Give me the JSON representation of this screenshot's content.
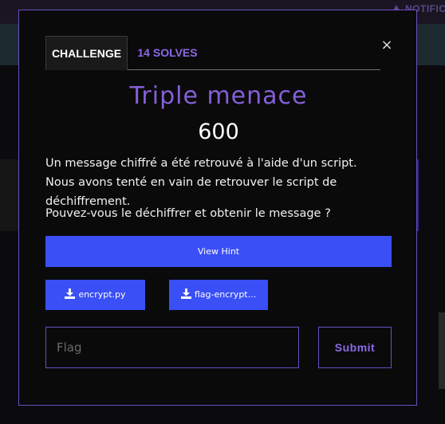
{
  "background": {
    "notification_label": "NOTIFIC"
  },
  "modal": {
    "close_label": "×",
    "tabs": [
      {
        "label": "CHALLENGE",
        "active": true
      },
      {
        "label": "14 SOLVES",
        "active": false
      }
    ],
    "challenge": {
      "title": "Triple menace",
      "points": "600",
      "description": "Un message chiffré a été retrouvé à l'aide d'un script. Nous avons tenté en vain de retrouver le script de déchiffrement.",
      "question": "Pouvez-vous le déchiffrer et obtenir le message ?"
    },
    "hint_button": "View Hint",
    "files": [
      {
        "label": "encrypt.py",
        "icon": "download-icon"
      },
      {
        "label": "flag-encrypt...",
        "icon": "download-icon"
      }
    ],
    "flag_input": {
      "placeholder": "Flag",
      "value": ""
    },
    "submit_button": "Submit"
  },
  "colors": {
    "accent_purple": "#8560d8",
    "border_purple": "#6a4fc0",
    "button_blue": "#3a4ff5",
    "modal_bg": "#0a0a0a"
  }
}
